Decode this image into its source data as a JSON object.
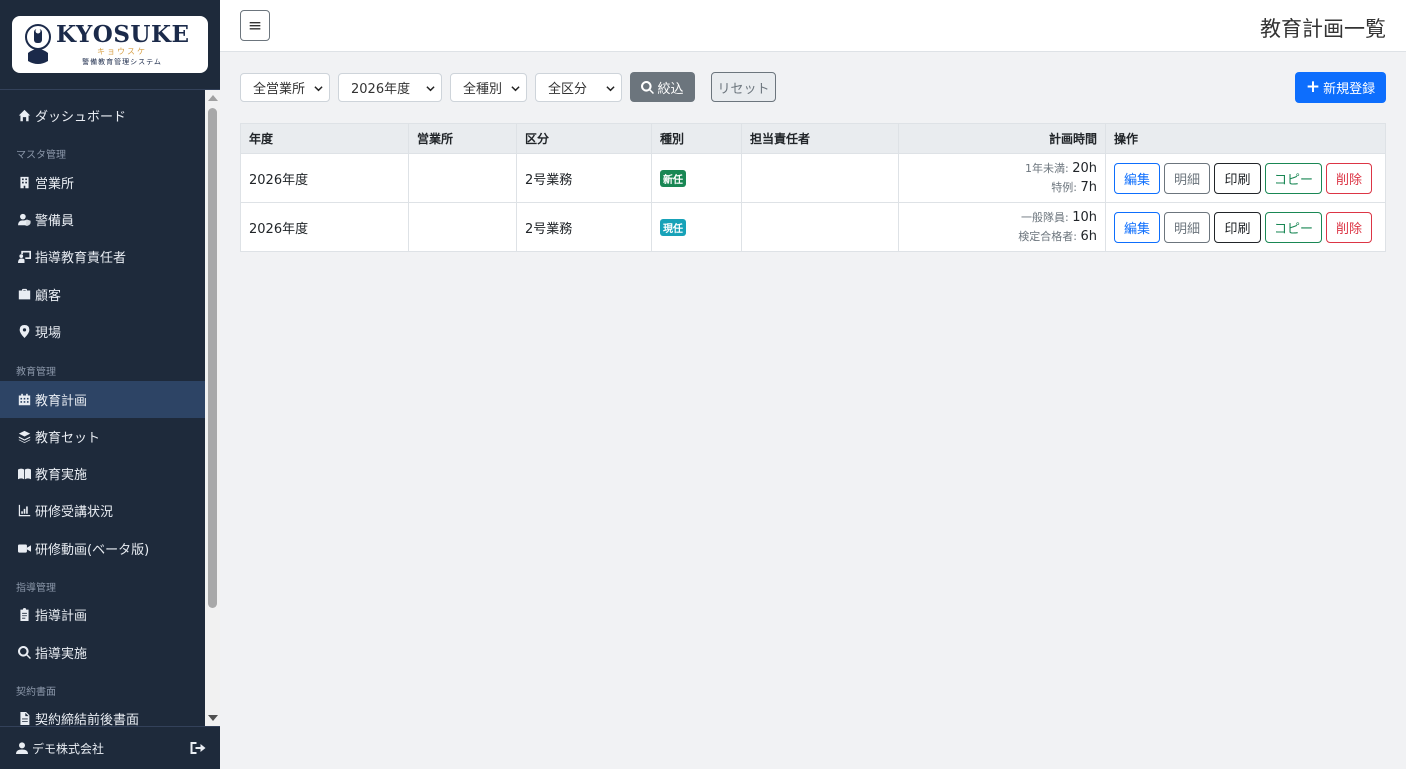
{
  "brand": {
    "name": "KYOSUKE",
    "kana": "キョウスケ",
    "subtitle": "警備教育管理システム"
  },
  "sidebar": {
    "items": [
      {
        "label": "ダッシュボード",
        "icon": "home-icon"
      },
      {
        "heading": "マスタ管理"
      },
      {
        "label": "営業所",
        "icon": "building-icon"
      },
      {
        "label": "警備員",
        "icon": "user-shield-icon"
      },
      {
        "label": "指導教育責任者",
        "icon": "chalkboard-teacher-icon"
      },
      {
        "label": "顧客",
        "icon": "briefcase-icon"
      },
      {
        "label": "現場",
        "icon": "map-marker-icon"
      },
      {
        "heading": "教育管理"
      },
      {
        "label": "教育計画",
        "icon": "calendar-icon",
        "active": true
      },
      {
        "label": "教育セット",
        "icon": "layers-icon"
      },
      {
        "label": "教育実施",
        "icon": "book-open-icon"
      },
      {
        "label": "研修受講状況",
        "icon": "chart-icon"
      },
      {
        "label": "研修動画(ベータ版)",
        "icon": "video-icon"
      },
      {
        "heading": "指導管理"
      },
      {
        "label": "指導計画",
        "icon": "clipboard-icon"
      },
      {
        "label": "指導実施",
        "icon": "search-icon"
      },
      {
        "heading": "契約書面"
      },
      {
        "label": "契約締結前後書面",
        "icon": "file-icon"
      }
    ],
    "footer": {
      "user": "デモ株式会社",
      "logout_icon": "logout-icon"
    }
  },
  "header": {
    "title": "教育計画一覧",
    "toggle_icon": "menu-icon",
    "toggle_label": "≡"
  },
  "filters": {
    "office": "全営業所",
    "year": "2026年度",
    "type": "全種別",
    "division": "全区分",
    "filter_button": "絞込",
    "reset_button": "リセット",
    "new_button": "新規登録"
  },
  "table": {
    "columns": [
      "年度",
      "営業所",
      "区分",
      "種別",
      "担当責任者",
      "計画時間",
      "操作"
    ],
    "rows": [
      {
        "year": "2026年度",
        "office": "",
        "division": "2号業務",
        "type": "新任",
        "type_color": "#198754",
        "manager": "",
        "times": [
          {
            "label": "1年未満:",
            "value": "20h"
          },
          {
            "label": "特例:",
            "value": "7h"
          }
        ]
      },
      {
        "year": "2026年度",
        "office": "",
        "division": "2号業務",
        "type": "現任",
        "type_color": "#17a2b8",
        "manager": "",
        "times": [
          {
            "label": "一般隊員:",
            "value": "10h"
          },
          {
            "label": "検定合格者:",
            "value": "6h"
          }
        ]
      }
    ],
    "actions": {
      "edit": "編集",
      "detail": "明細",
      "print": "印刷",
      "copy": "コピー",
      "delete": "削除"
    }
  },
  "colors": {
    "sidebar_bg": "#1e2a3b",
    "active_bg": "#2d4465",
    "primary": "#0d6efd"
  }
}
